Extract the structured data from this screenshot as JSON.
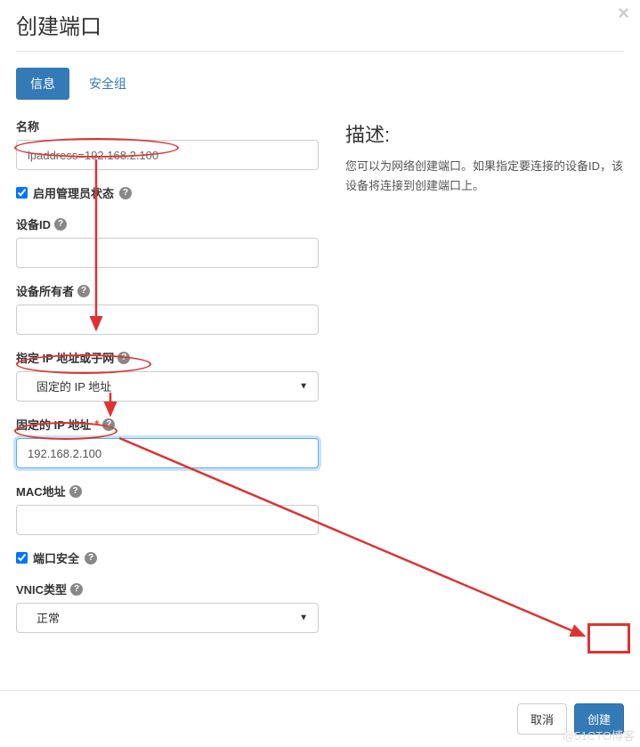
{
  "header": {
    "title": "创建端口"
  },
  "tabs": {
    "info": "信息",
    "security": "安全组"
  },
  "fields": {
    "name_label": "名称",
    "name_value": "ipaddress=192.168.2.100",
    "enable_admin_state": "启用管理员状态",
    "device_id_label": "设备ID",
    "device_id_value": "",
    "device_owner_label": "设备所有者",
    "device_owner_value": "",
    "specify_ip_label": "指定 IP 地址或子网",
    "specify_ip_selected": "固定的 IP 地址",
    "fixed_ip_label": "固定的 IP 地址",
    "fixed_ip_value": "192.168.2.100",
    "mac_label": "MAC地址",
    "mac_value": "",
    "port_security": "端口安全",
    "vnic_label": "VNIC类型",
    "vnic_selected": "正常"
  },
  "description": {
    "heading": "描述:",
    "text": "您可以为网络创建端口。如果指定要连接的设备ID，该设备将连接到创建端口上。"
  },
  "footer": {
    "cancel": "取消",
    "create": "创建"
  },
  "watermark": "@51CTO博客"
}
